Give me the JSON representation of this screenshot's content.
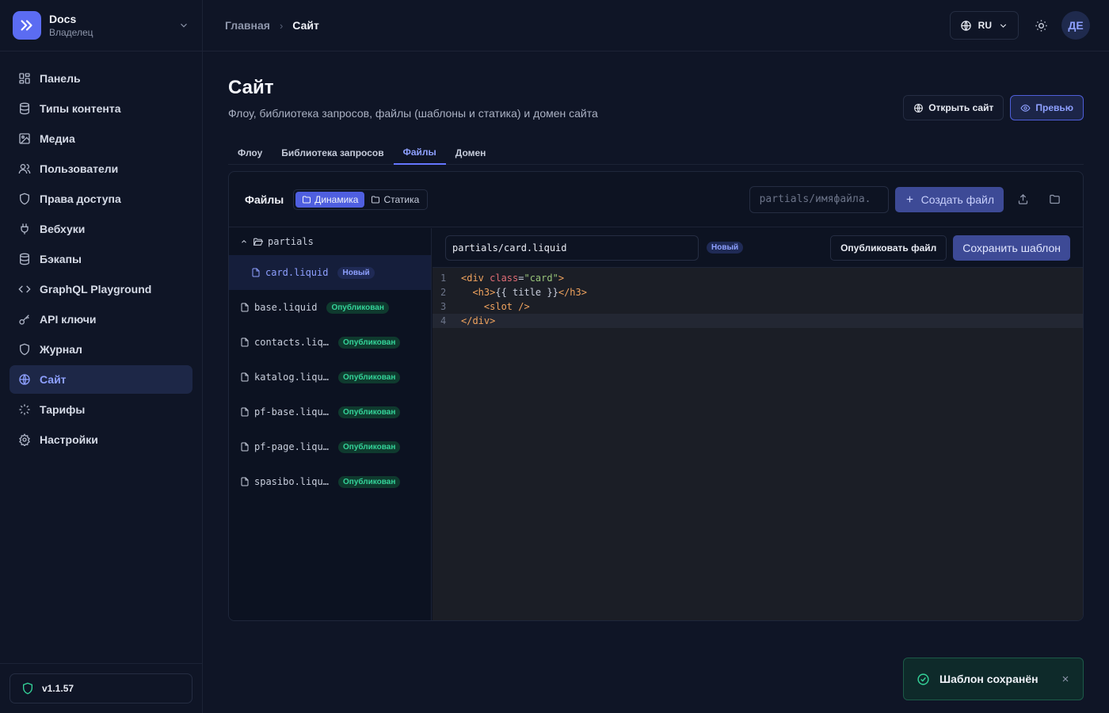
{
  "brand": {
    "name": "Docs",
    "role": "Владелец"
  },
  "sidebar": {
    "items": [
      {
        "label": "Панель",
        "icon": "dashboard-icon"
      },
      {
        "label": "Типы контента",
        "icon": "database-icon"
      },
      {
        "label": "Медиа",
        "icon": "image-icon"
      },
      {
        "label": "Пользователи",
        "icon": "users-icon"
      },
      {
        "label": "Права доступа",
        "icon": "shield-icon"
      },
      {
        "label": "Вебхуки",
        "icon": "plug-icon"
      },
      {
        "label": "Бэкапы",
        "icon": "database-icon"
      },
      {
        "label": "GraphQL Playground",
        "icon": "code-icon"
      },
      {
        "label": "API ключи",
        "icon": "key-icon"
      },
      {
        "label": "Журнал",
        "icon": "shield-icon"
      },
      {
        "label": "Сайт",
        "icon": "globe-icon",
        "active": true
      },
      {
        "label": "Тарифы",
        "icon": "loader-icon"
      },
      {
        "label": "Настройки",
        "icon": "gear-icon"
      }
    ],
    "version": "v1.1.57"
  },
  "topbar": {
    "breadcrumb": [
      "Главная",
      "Сайт"
    ],
    "lang": "RU",
    "avatar": "ДЕ"
  },
  "page": {
    "title": "Сайт",
    "subtitle": "Флоу, библиотека запросов, файлы (шаблоны и статика) и домен сайта",
    "open_site": "Открыть сайт",
    "preview": "Превью"
  },
  "tabs": [
    {
      "label": "Флоу"
    },
    {
      "label": "Библиотека запросов"
    },
    {
      "label": "Файлы",
      "active": true
    },
    {
      "label": "Домен"
    }
  ],
  "files": {
    "title": "Файлы",
    "seg_dynamic": "Динамика",
    "seg_static": "Статика",
    "new_placeholder": "partials/имяфайла.",
    "create_label": "Создать файл",
    "folder": "partials",
    "tree": [
      {
        "name": "card.liquid",
        "status": "Новый",
        "kind": "new",
        "active": true,
        "nested": true
      },
      {
        "name": "base.liquid",
        "status": "Опубликован",
        "kind": "pub"
      },
      {
        "name": "contacts.liquid",
        "status": "Опубликован",
        "kind": "pub"
      },
      {
        "name": "katalog.liquid",
        "status": "Опубликован",
        "kind": "pub"
      },
      {
        "name": "pf-base.liquid",
        "status": "Опубликован",
        "kind": "pub"
      },
      {
        "name": "pf-page.liquid",
        "status": "Опубликован",
        "kind": "pub"
      },
      {
        "name": "spasibo.liquid",
        "status": "Опубликован",
        "kind": "pub"
      }
    ]
  },
  "editor": {
    "path": "partials/card.liquid",
    "status": "Новый",
    "publish_label": "Опубликовать файл",
    "save_label": "Сохранить шаблон",
    "lines": [
      {
        "n": "1",
        "tokens": [
          [
            "tag",
            "<div "
          ],
          [
            "attr",
            "class"
          ],
          [
            "punc",
            "="
          ],
          [
            "str",
            "\"card\""
          ],
          [
            "tag",
            ">"
          ]
        ]
      },
      {
        "n": "2",
        "tokens": [
          [
            "plain",
            "  "
          ],
          [
            "tag",
            "<h3>"
          ],
          [
            "plain",
            "{{ title }}"
          ],
          [
            "tag",
            "</h3>"
          ]
        ]
      },
      {
        "n": "3",
        "tokens": [
          [
            "plain",
            "    "
          ],
          [
            "tag",
            "<slot />"
          ]
        ]
      },
      {
        "n": "4",
        "tokens": [
          [
            "tag",
            "</div>"
          ]
        ],
        "current": true
      }
    ]
  },
  "toast": {
    "text": "Шаблон сохранён"
  },
  "colors": {
    "accent": "#6476ff",
    "success": "#34d399",
    "bg": "#0f1526"
  }
}
